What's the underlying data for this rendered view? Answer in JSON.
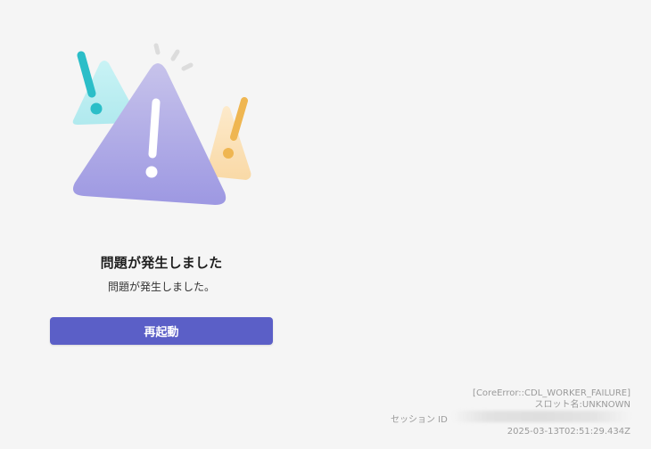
{
  "error": {
    "title": "問題が発生しました",
    "message": "問題が発生しました。",
    "restart_label": "再起動"
  },
  "illustration": {
    "icon": "warning-triangles-icon",
    "colors": {
      "main_triangle": "#a8a4e0",
      "left_triangle": "#bdeff2",
      "left_mark": "#2bbec8",
      "right_triangle": "#fbe0b4",
      "right_mark": "#efb651"
    }
  },
  "diagnostics": {
    "error_code": "[CoreError::CDL_WORKER_FAILURE]",
    "slot_name": "スロット名:UNKNOWN",
    "session_label": "セッション ID",
    "timestamp": "2025-03-13T02:51:29.434Z"
  },
  "colors": {
    "accent": "#5b5fc7",
    "background": "#f5f5f5"
  }
}
